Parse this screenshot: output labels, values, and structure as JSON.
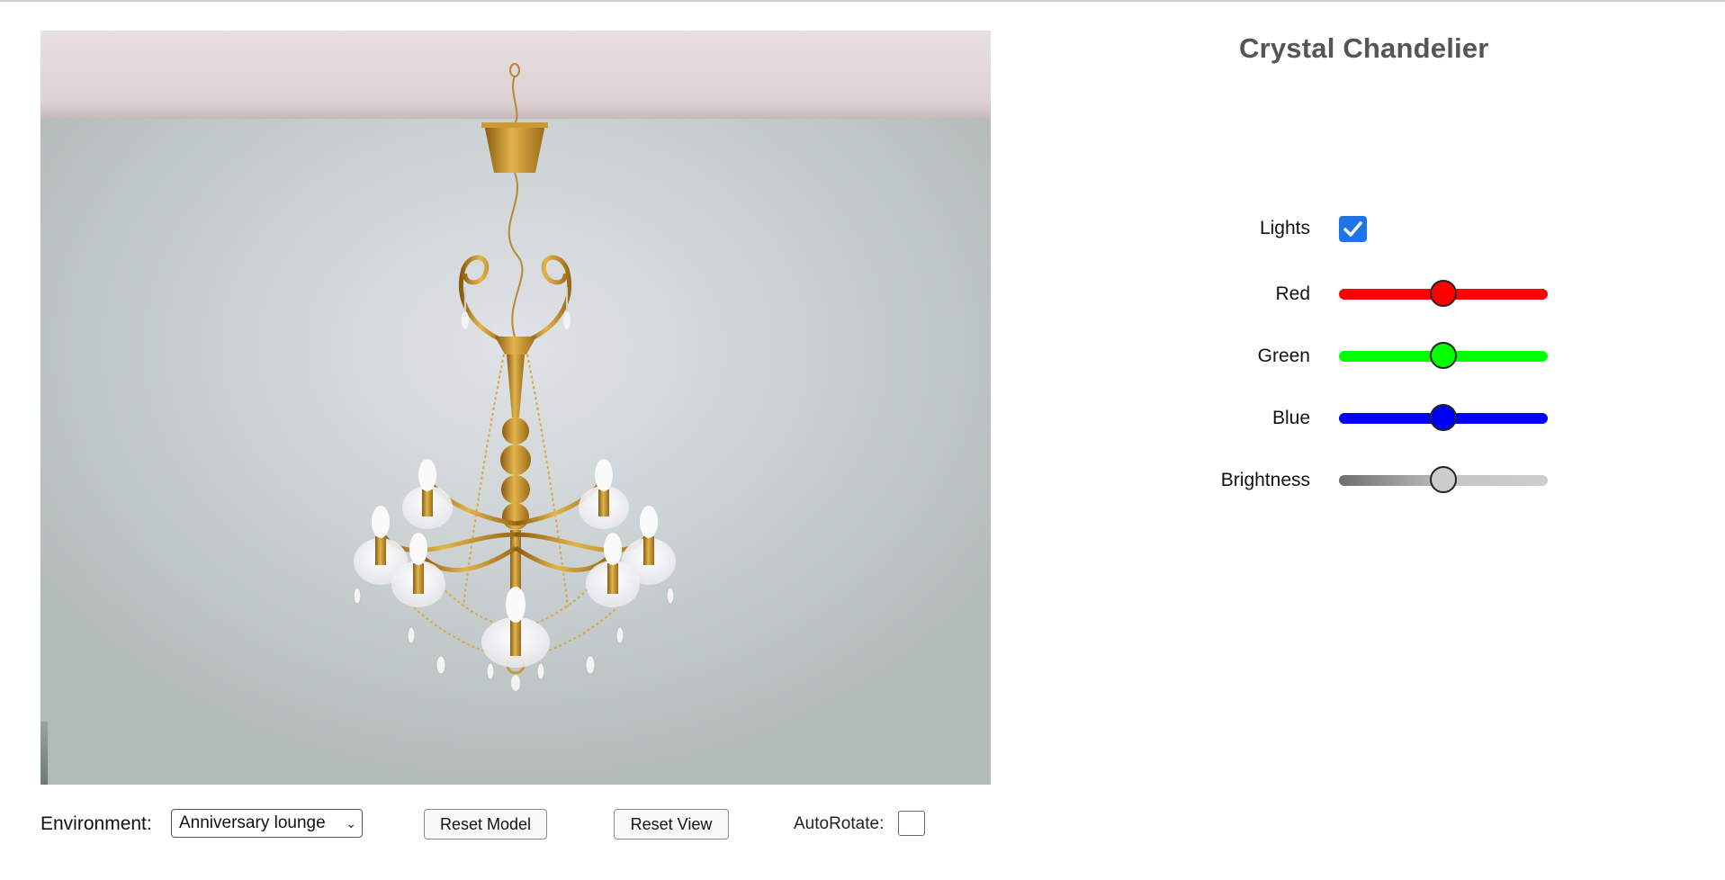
{
  "app": {
    "title": "Crystal Chandelier"
  },
  "viewer": {
    "model": "crystal-chandelier",
    "ceiling_color": "#e2d8d9",
    "wall_color": "#c9cfd1"
  },
  "panel": {
    "lights": {
      "label": "Lights",
      "checked": true,
      "accent": "#1f74e8"
    },
    "sliders": [
      {
        "key": "red",
        "label": "Red",
        "value": 0.5,
        "track": "#ff0000",
        "thumb": "#ff0000"
      },
      {
        "key": "green",
        "label": "Green",
        "value": 0.5,
        "track": "#00ff00",
        "thumb": "#00ff00"
      },
      {
        "key": "blue",
        "label": "Blue",
        "value": 0.5,
        "track": "#0000ff",
        "thumb": "#0000ff"
      },
      {
        "key": "brightness",
        "label": "Brightness",
        "value": 0.5,
        "track": "gradient-gray",
        "thumb": "#cccccc"
      }
    ]
  },
  "controls": {
    "environment_label": "Environment:",
    "environment_value": "Anniversary lounge",
    "reset_model_label": "Reset Model",
    "reset_view_label": "Reset View",
    "autorotate_label": "AutoRotate:",
    "autorotate_checked": false
  },
  "icons": {
    "dropdown": "chevron-down-icon",
    "check": "check-icon"
  }
}
